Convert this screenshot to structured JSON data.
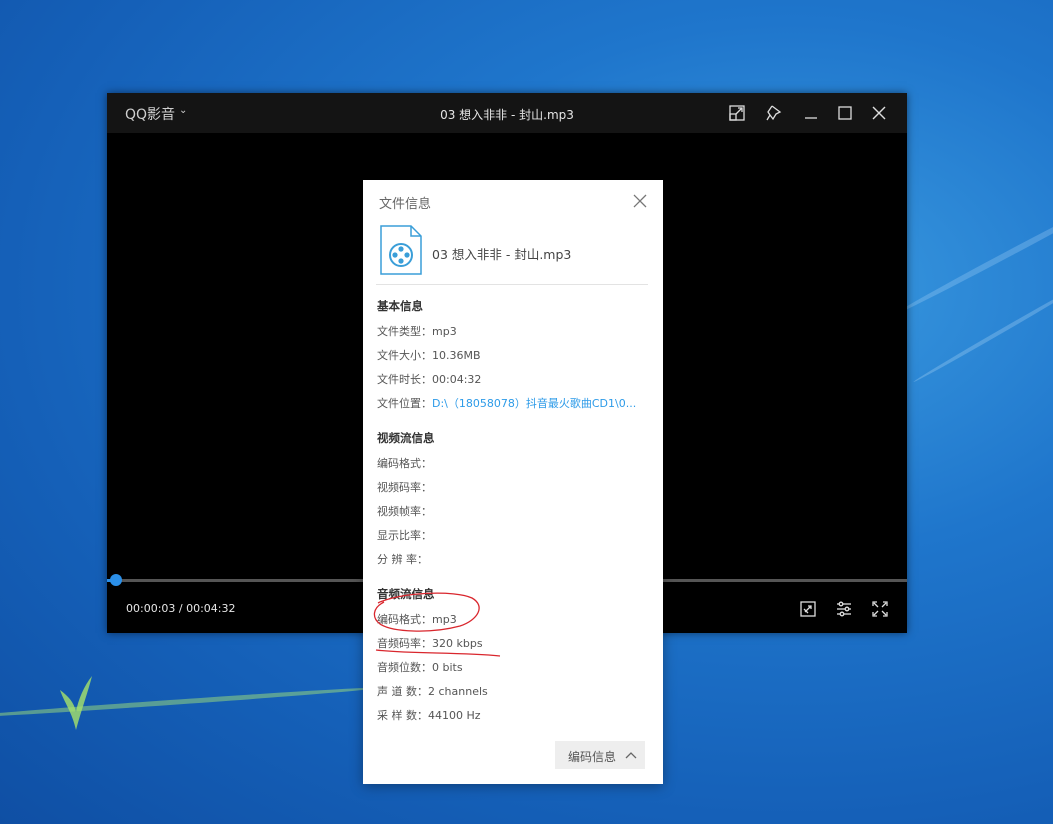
{
  "window": {
    "app_name": "QQ影音",
    "title": "03 想入非非 - 封山.mp3",
    "icons": [
      "mini-mode-icon",
      "pin-icon",
      "minimize-icon",
      "maximize-icon",
      "close-icon"
    ]
  },
  "player": {
    "time": "00:00:03 / 00:04:32",
    "progress_fraction": 0.011,
    "bottom_icons": [
      "screenshot-icon",
      "settings-icon",
      "fullscreen-icon"
    ],
    "accent": "#2b8fe8"
  },
  "dialog": {
    "title": "文件信息",
    "file_name": "03 想入非非 - 封山.mp3",
    "basic": {
      "header": "基本信息",
      "rows": [
        {
          "key": "文件类型：",
          "value": "mp3"
        },
        {
          "key": "文件大小：",
          "value": "10.36MB"
        },
        {
          "key": "文件时长：",
          "value": "00:04:32"
        },
        {
          "key": "文件位置：",
          "value": "D:\\（18058078）抖音最火歌曲CD1\\0..."
        }
      ]
    },
    "video": {
      "header": "视频流信息",
      "rows": [
        {
          "key": "编码格式：",
          "value": ""
        },
        {
          "key": "视频码率：",
          "value": ""
        },
        {
          "key": "视频帧率：",
          "value": ""
        },
        {
          "key": "显示比率：",
          "value": ""
        },
        {
          "key": "分 辨 率：",
          "value": ""
        }
      ]
    },
    "audio": {
      "header": "音频流信息",
      "rows": [
        {
          "key": "编码格式：",
          "value": "mp3"
        },
        {
          "key": "音频码率：",
          "value": "320 kbps"
        },
        {
          "key": "音频位数：",
          "value": "0 bits"
        },
        {
          "key": "声 道 数：",
          "value": "2 channels"
        },
        {
          "key": "采 样 数：",
          "value": "44100 Hz"
        }
      ]
    },
    "encode_button": "编码信息",
    "link_color": "#2d9be8"
  }
}
